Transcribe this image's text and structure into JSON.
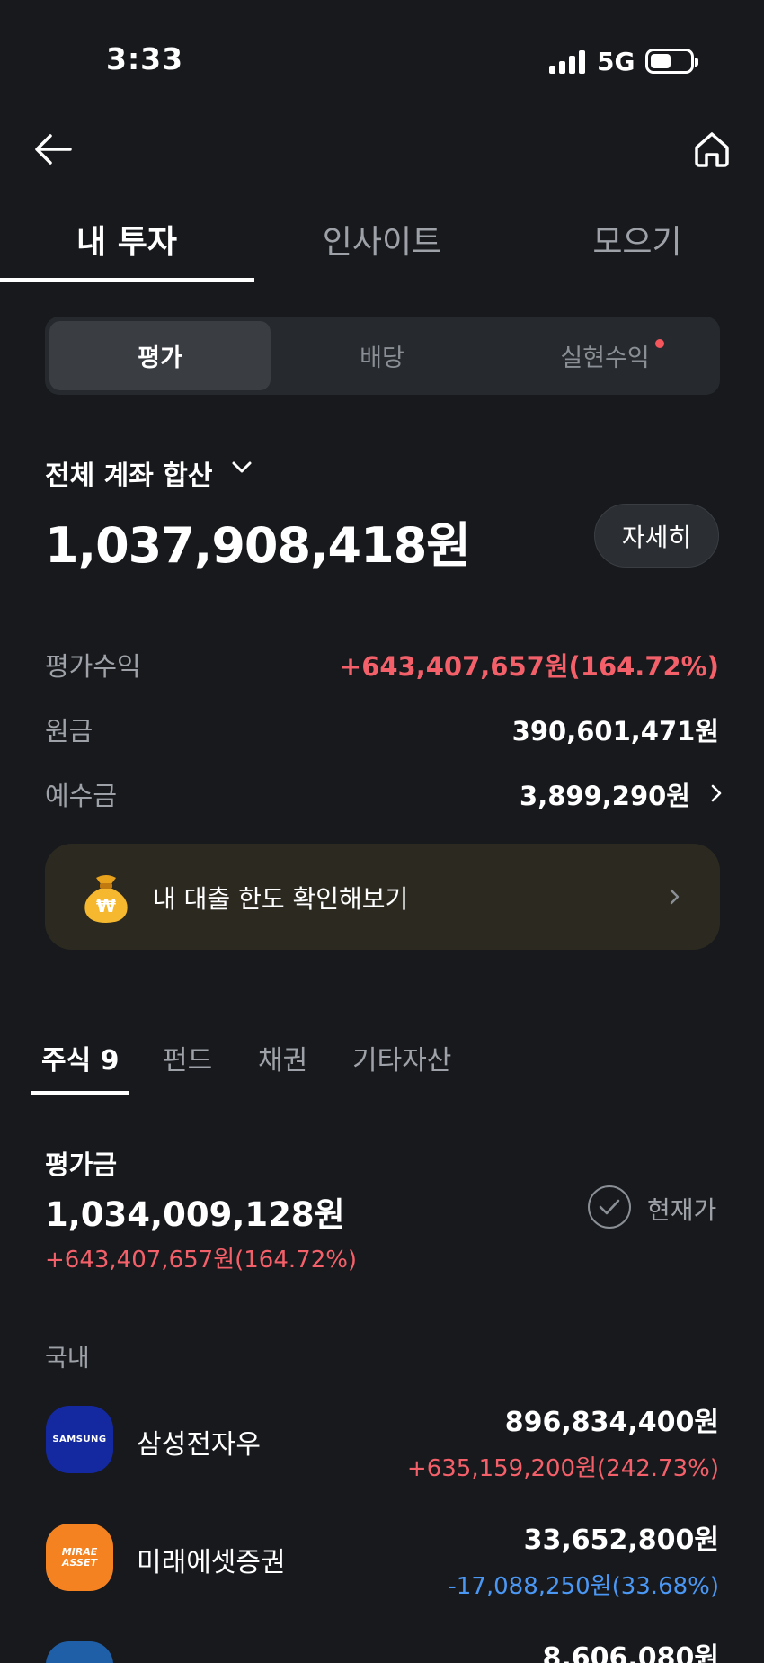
{
  "status_bar": {
    "time": "3:33",
    "network": "5G"
  },
  "nav": {
    "tabs": [
      {
        "label": "내 투자",
        "active": true
      },
      {
        "label": "인사이트",
        "active": false
      },
      {
        "label": "모으기",
        "active": false
      }
    ]
  },
  "segment": {
    "options": [
      {
        "label": "평가",
        "active": true
      },
      {
        "label": "배당",
        "active": false
      },
      {
        "label": "실현수익",
        "active": false,
        "has_dot": true
      }
    ]
  },
  "account": {
    "label": "전체 계좌 합산",
    "total": "1,037,908,418원",
    "detail_label": "자세히",
    "rows": [
      {
        "label": "평가수익",
        "value": "+643,407,657원(164.72%)",
        "color": "#f4606a"
      },
      {
        "label": "원금",
        "value": "390,601,471원",
        "color": "#ffffff"
      },
      {
        "label": "예수금",
        "value": "3,899,290원",
        "color": "#ffffff"
      }
    ]
  },
  "banner": {
    "text": "내 대출 한도 확인해보기",
    "icon": "money-bag-icon"
  },
  "asset_tabs": [
    {
      "label": "주식 9",
      "active": true
    },
    {
      "label": "펀드",
      "active": false
    },
    {
      "label": "채권",
      "active": false
    },
    {
      "label": "기타자산",
      "active": false
    }
  ],
  "evaluation": {
    "label": "평가금",
    "total": "1,034,009,128원",
    "gain": "+643,407,657원(164.72%)",
    "toggle_label": "현재가"
  },
  "domestic": {
    "section_label": "국내",
    "stocks": [
      {
        "name": "삼성전자우",
        "logo_text": "SAMSUNG",
        "logo_color": "#1428a0",
        "value": "896,834,400원",
        "gain": "+635,159,200원(242.73%)",
        "gain_color": "#f4606a"
      },
      {
        "name": "미래에셋증권",
        "logo_text": "MIRAE ASSET",
        "logo_color": "#f58220",
        "value": "33,652,800원",
        "gain": "-17,088,250원(33.68%)",
        "gain_color": "#4b97f4"
      },
      {
        "name": "",
        "logo_text": "",
        "logo_color": "#1f5fa8",
        "value": "8,606,080원",
        "gain": "",
        "gain_color": "#f4606a"
      }
    ]
  },
  "colors": {
    "background": "#17191c",
    "positive": "#f4606a",
    "negative": "#4b97f4"
  }
}
